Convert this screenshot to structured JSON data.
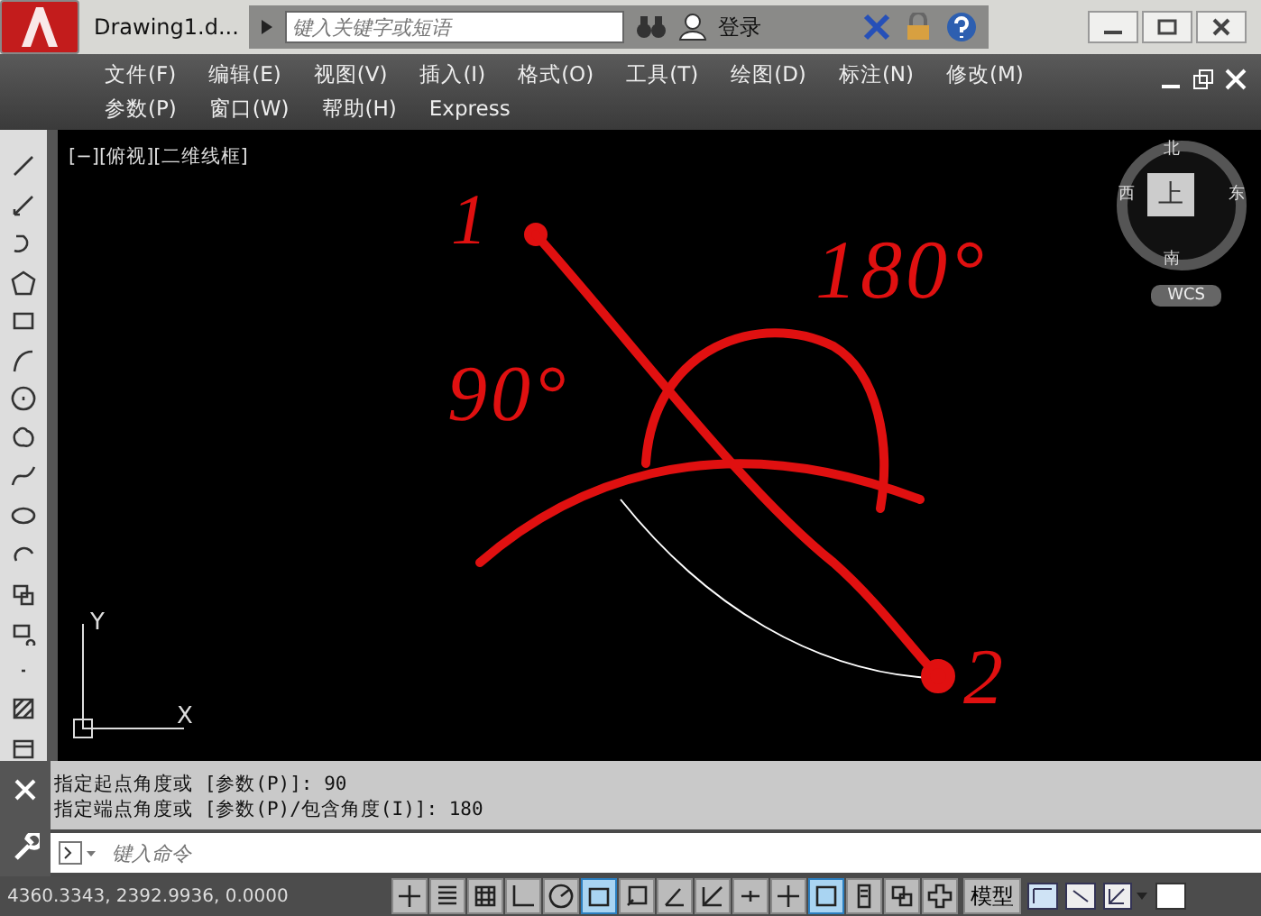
{
  "title_bar": {
    "document_title": "Drawing1.d...",
    "search": {
      "placeholder": "键入关键字或短语"
    },
    "sign_in": "登录"
  },
  "menu_bar": {
    "rows": [
      [
        "文件(F)",
        "编辑(E)",
        "视图(V)",
        "插入(I)",
        "格式(O)",
        "工具(T)",
        "绘图(D)",
        "标注(N)",
        "修改(M)"
      ],
      [
        "参数(P)",
        "窗口(W)",
        "帮助(H)",
        "Express"
      ]
    ]
  },
  "viewport": {
    "label": "[−][俯视][二维线框]",
    "view_cube": {
      "north": "北",
      "south": "南",
      "west": "西",
      "east": "东",
      "face": "上",
      "ucs": "WCS"
    },
    "axis_y": "Y",
    "axis_x": "X",
    "annotations": [
      {
        "text": "1",
        "kind": "number"
      },
      {
        "text": "90°",
        "kind": "angle"
      },
      {
        "text": "180°",
        "kind": "angle"
      },
      {
        "text": "2",
        "kind": "number"
      }
    ]
  },
  "command_history": [
    "指定起点角度或 [参数(P)]: 90",
    "指定端点角度或 [参数(P)/包含角度(I)]: 180"
  ],
  "command_input": {
    "placeholder": "键入命令"
  },
  "status_bar": {
    "coordinates": "4360.3343, 2392.9936, 0.0000",
    "toggles": [
      {
        "on": false
      },
      {
        "on": false
      },
      {
        "on": false
      },
      {
        "on": false
      },
      {
        "on": false
      },
      {
        "on": true
      },
      {
        "on": false
      },
      {
        "on": false
      },
      {
        "on": false
      },
      {
        "on": false
      },
      {
        "on": false
      },
      {
        "on": true
      },
      {
        "on": false
      },
      {
        "on": false
      },
      {
        "on": false
      }
    ],
    "model_label": "模型"
  }
}
